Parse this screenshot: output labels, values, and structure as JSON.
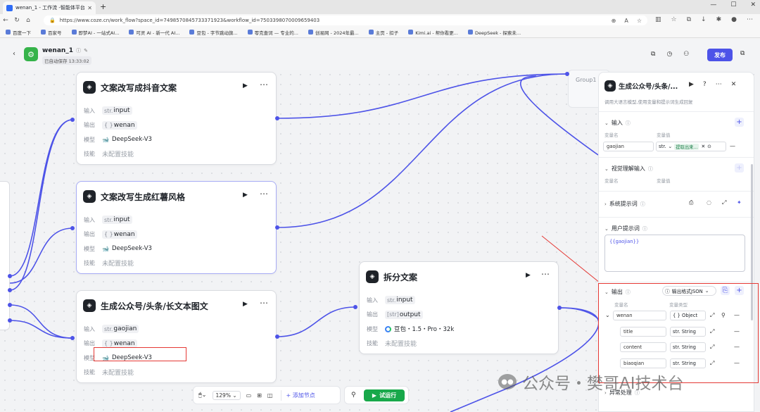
{
  "browser": {
    "tab_title": "wenan_1 - 工作流 -智能体平台",
    "url": "https://www.coze.cn/work_flow?space_id=7498570845733371923&workflow_id=7503398070009659403",
    "bookmarks": [
      "百度一下",
      "百家号",
      "即梦AI - 一站式AI...",
      "可灵 AI - 新一代 AI...",
      "豆包 - 字节跳动旗...",
      "零克查词 — 专业的...",
      "创易网 - 2024年最...",
      "主页 - 扣子",
      "Kimi.ai - 帮你看更...",
      "DeepSeek - 探索未..."
    ]
  },
  "header": {
    "workflow_name": "wenan_1",
    "saved_text": "已自动保存 13:33:02",
    "publish_label": "发布"
  },
  "nodes": [
    {
      "title": "文案改写成抖音文案",
      "rows": [
        {
          "label": "输入",
          "type": "str.",
          "value": "input"
        },
        {
          "label": "输出",
          "type": "{ }",
          "value": "wenan"
        },
        {
          "label": "模型",
          "value": "DeepSeek-V3"
        },
        {
          "label": "技能",
          "value": "未配置技能"
        }
      ]
    },
    {
      "title": "文案改写生成红薯风格",
      "rows": [
        {
          "label": "输入",
          "type": "str.",
          "value": "input"
        },
        {
          "label": "输出",
          "type": "{ }",
          "value": "wenan"
        },
        {
          "label": "模型",
          "value": "DeepSeek-V3"
        },
        {
          "label": "技能",
          "value": "未配置技能"
        }
      ]
    },
    {
      "title": "生成公众号/头条/长文本图文",
      "rows": [
        {
          "label": "输入",
          "type": "str.",
          "value": "gaojian"
        },
        {
          "label": "输出",
          "type": "{ }",
          "value": "wenan"
        },
        {
          "label": "模型",
          "value": "DeepSeek-V3"
        },
        {
          "label": "技能",
          "value": "未配置技能"
        }
      ]
    },
    {
      "title": "拆分文案",
      "rows": [
        {
          "label": "输入",
          "type": "str.",
          "value": "input"
        },
        {
          "label": "输出",
          "type": "[str]",
          "value": "output"
        },
        {
          "label": "模型",
          "value": "豆包・1.5・Pro・32k"
        },
        {
          "label": "技能",
          "value": "未配置技能"
        }
      ]
    }
  ],
  "group_label": "Group1",
  "panel": {
    "title": "生成公众号/头条/...",
    "description": "调用大语言模型,使用变量和提示词生成回复",
    "input_label": "输入",
    "col_var_name": "变量名",
    "col_var_value": "变量值",
    "input_var": "gaojian",
    "input_type": "str.",
    "input_ref": "提取出来...",
    "vision_label": "视觉理解输入",
    "system_prompt_label": "系统提示词",
    "user_prompt_label": "用户提示词",
    "user_prompt_value": "{{gaojian}}",
    "output_label": "输出",
    "output_format": "输出格式JSON",
    "col_type": "变量类型",
    "outputs": [
      {
        "name": "wenan",
        "type": "{ } Object"
      },
      {
        "name": "title",
        "type": "str. String"
      },
      {
        "name": "content",
        "type": "str. String"
      },
      {
        "name": "biaoqian",
        "type": "str. String"
      }
    ],
    "exception_label": "异常处理"
  },
  "toolbar": {
    "zoom": "129%",
    "add_node": "添加节点",
    "test_run": "试运行"
  },
  "watermark": "公众号・樊哥AI技术台"
}
